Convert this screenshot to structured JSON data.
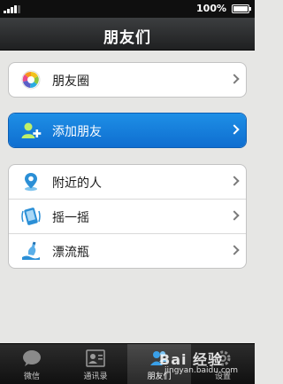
{
  "status_bar": {
    "battery_text": "100%"
  },
  "header": {
    "title": "朋友们"
  },
  "groups": [
    {
      "items": [
        {
          "label": "朋友圈",
          "icon": "moments-icon"
        }
      ]
    },
    {
      "items": [
        {
          "label": "添加朋友",
          "icon": "add-friend-icon",
          "highlighted": true
        }
      ]
    },
    {
      "items": [
        {
          "label": "附近的人",
          "icon": "location-pin-icon"
        },
        {
          "label": "摇一摇",
          "icon": "shake-icon"
        },
        {
          "label": "漂流瓶",
          "icon": "drift-bottle-icon"
        }
      ]
    }
  ],
  "tabs": [
    {
      "label": "微信",
      "icon": "chat-bubble-icon"
    },
    {
      "label": "通讯录",
      "icon": "contacts-icon"
    },
    {
      "label": "朋友们",
      "icon": "friends-icon",
      "active": true
    },
    {
      "label": "设置",
      "icon": "gear-icon"
    }
  ],
  "watermark": {
    "text": "Bai 经验",
    "url": "jingyan.baidu.com"
  },
  "colors": {
    "highlight": "#1a84e0",
    "title_bar": "#2e2f30",
    "background": "#e6e6e4",
    "tab_bar": "#1a1a1a"
  }
}
